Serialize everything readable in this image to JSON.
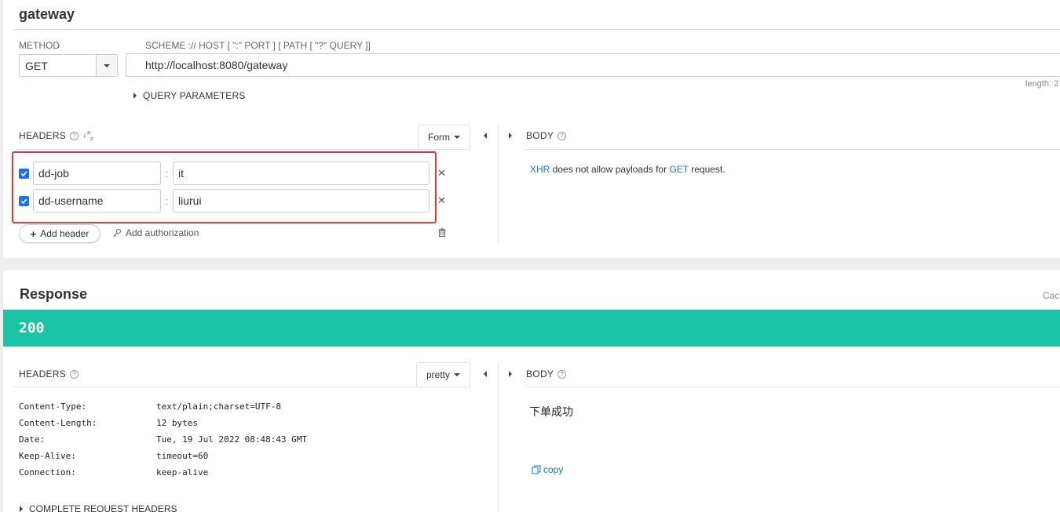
{
  "request": {
    "title": "gateway",
    "method_label": "METHOD",
    "scheme_label": "SCHEME :// HOST [ \":\" PORT ] [ PATH [ \"?\" QUERY ]]",
    "method_value": "GET",
    "url": "http://localhost:8080/gateway",
    "length_label": "length: 2",
    "query_params_label": "QUERY PARAMETERS",
    "headers_label": "HEADERS",
    "form_label": "Form",
    "body_label": "BODY",
    "headers": [
      {
        "enabled": true,
        "name": "dd-job",
        "value": "it"
      },
      {
        "enabled": true,
        "name": "dd-username",
        "value": "liurui"
      }
    ],
    "add_header_label": "Add header",
    "add_auth_label": "Add authorization",
    "body_note": {
      "pre_link": "XHR",
      "middle": " does not allow payloads for ",
      "method_link": "GET",
      "post": " request."
    }
  },
  "response": {
    "title": "Response",
    "cache_label": "Cac",
    "status_code": "200",
    "headers_label": "HEADERS",
    "pretty_label": "pretty",
    "body_label": "BODY",
    "headers": [
      {
        "key": "Content-Type:",
        "value": "text/plain;charset=UTF-8"
      },
      {
        "key": "Content-Length:",
        "value": "12 bytes"
      },
      {
        "key": "Date:",
        "value": "Tue, 19 Jul 2022 08:48:43 GMT"
      },
      {
        "key": "Keep-Alive:",
        "value": "timeout=60"
      },
      {
        "key": "Connection:",
        "value": "keep-alive"
      }
    ],
    "body_text": "下单成功",
    "copy_label": "copy",
    "complete_headers_label": "COMPLETE REQUEST HEADERS"
  },
  "colors": {
    "status_bar": "#1bc4a6",
    "link": "#1a73e8",
    "highlight_box": "#e53935"
  }
}
